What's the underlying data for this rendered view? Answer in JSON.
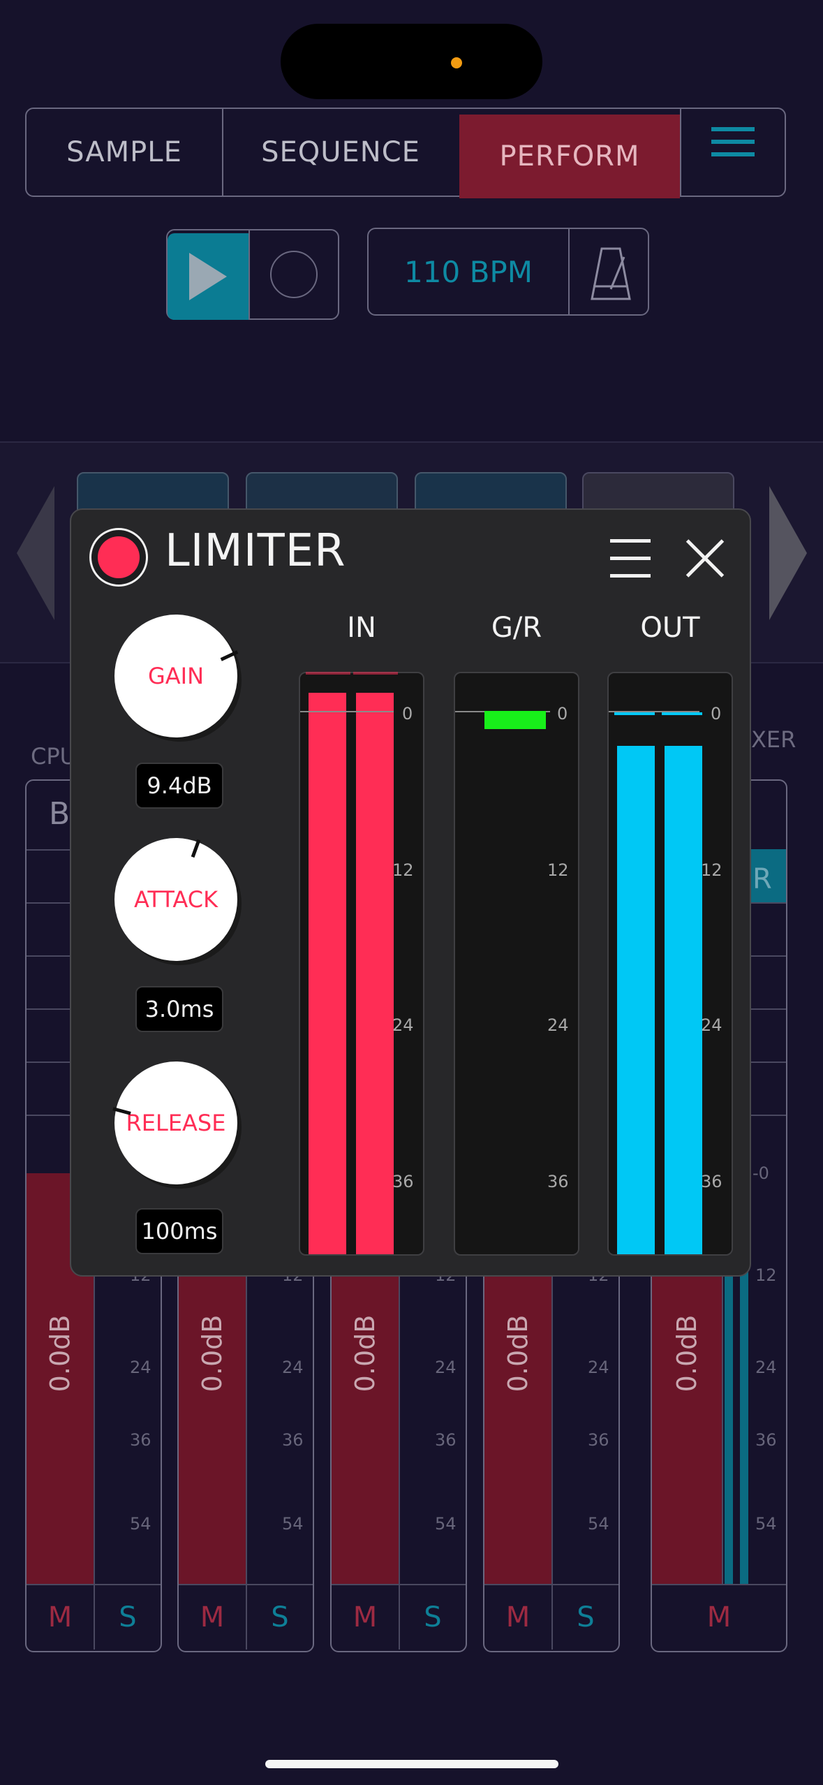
{
  "tabs": [
    {
      "label": "SAMPLE",
      "active": false
    },
    {
      "label": "SEQUENCE",
      "active": false
    },
    {
      "label": "PERFORM",
      "active": true
    }
  ],
  "transport": {
    "bpm": "110 BPM"
  },
  "side_labels": {
    "left": "CPU",
    "right": "XER",
    "left_partial": "B",
    "right_partial": "R"
  },
  "channels": [
    {
      "db": "0.0dB",
      "mute": "M",
      "solo": "S"
    },
    {
      "db": "0.0dB",
      "mute": "M",
      "solo": "S"
    },
    {
      "db": "0.0dB",
      "mute": "M",
      "solo": "S"
    },
    {
      "db": "0.0dB",
      "mute": "M",
      "solo": "S"
    },
    {
      "db": "0.0dB",
      "mute": "M"
    }
  ],
  "channel_ticks": [
    "12",
    "24",
    "36",
    "54"
  ],
  "master_tick_top": "-0",
  "limiter": {
    "title": "LIMITER",
    "knobs": [
      {
        "label": "GAIN",
        "value": "9.4dB"
      },
      {
        "label": "ATTACK",
        "value": "3.0ms"
      },
      {
        "label": "RELEASE",
        "value": "100ms"
      }
    ],
    "meters": [
      {
        "label": "IN",
        "ticks": [
          "0",
          "12",
          "24",
          "36"
        ]
      },
      {
        "label": "G/R",
        "ticks": [
          "0",
          "12",
          "24",
          "36"
        ]
      },
      {
        "label": "OUT",
        "ticks": [
          "0",
          "12",
          "24",
          "36"
        ]
      }
    ]
  },
  "colors": {
    "background": "#16122b",
    "accent_red": "#ff2d55",
    "accent_cyan": "#00c8f5",
    "accent_green": "#18ef1a",
    "teal": "#0e8aa3"
  }
}
